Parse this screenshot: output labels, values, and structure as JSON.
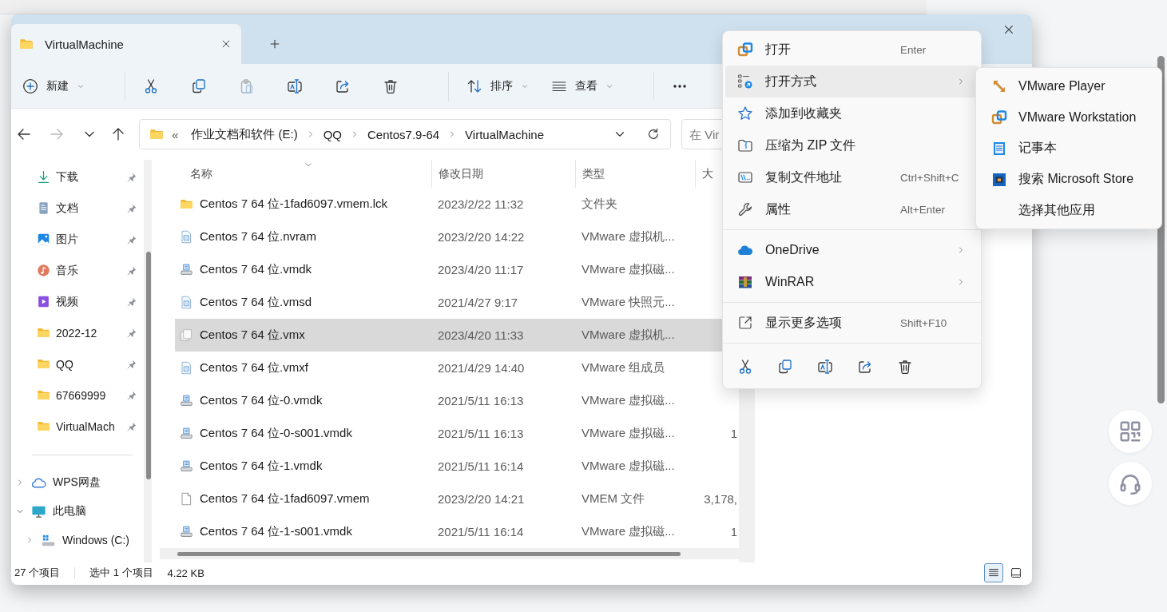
{
  "window": {
    "tabs": [
      {
        "title": "VirtualMachine",
        "selected": true
      }
    ]
  },
  "command_bar": [
    {
      "kind": "new",
      "label": "新建",
      "disabled": false
    },
    {
      "kind": "separator"
    },
    {
      "kind": "cut",
      "disabled": false
    },
    {
      "kind": "copy",
      "disabled": false
    },
    {
      "kind": "paste",
      "disabled": true
    },
    {
      "kind": "rename",
      "disabled": false
    },
    {
      "kind": "share",
      "disabled": false
    },
    {
      "kind": "delete",
      "disabled": false
    },
    {
      "kind": "separator"
    },
    {
      "kind": "sort",
      "label": "排序",
      "disabled": false
    },
    {
      "kind": "view",
      "label": "查看",
      "disabled": false
    },
    {
      "kind": "separator"
    },
    {
      "kind": "more",
      "disabled": false
    }
  ],
  "navigation": [
    {
      "kind": "back",
      "disabled": false
    },
    {
      "kind": "forward",
      "disabled": true
    },
    {
      "kind": "recent",
      "disabled": false
    },
    {
      "kind": "up",
      "disabled": false
    }
  ],
  "address_bar": {
    "overflow": "«",
    "crumbs": [
      "作业文档和软件 (E:)",
      "QQ",
      "Centos7.9-64",
      "VirtualMachine"
    ]
  },
  "search": {
    "placeholder": "在 Vir"
  },
  "sidebar": {
    "quick_access": [
      {
        "label": "下载",
        "kind": "downloads",
        "pinned": true
      },
      {
        "label": "文档",
        "kind": "documents",
        "pinned": true
      },
      {
        "label": "图片",
        "kind": "pictures",
        "pinned": true
      },
      {
        "label": "音乐",
        "kind": "music",
        "pinned": true
      },
      {
        "label": "视频",
        "kind": "videos",
        "pinned": true
      },
      {
        "label": "2022-12",
        "kind": "folder",
        "pinned": true
      },
      {
        "label": "QQ",
        "kind": "folder",
        "pinned": true
      },
      {
        "label": "67669999",
        "kind": "folder",
        "pinned": true
      },
      {
        "label": "VirtualMach",
        "kind": "folder",
        "pinned": true
      }
    ],
    "tree": [
      {
        "label": "WPS网盘",
        "kind": "cloud",
        "expanded": false
      },
      {
        "label": "此电脑",
        "kind": "pc",
        "expanded": true,
        "children": [
          {
            "label": "Windows (C:)",
            "kind": "drive",
            "expanded": false
          }
        ]
      }
    ]
  },
  "file_list": {
    "columns": [
      {
        "label": "名称",
        "sorted": true
      },
      {
        "label": "修改日期",
        "sorted": false
      },
      {
        "label": "类型",
        "sorted": false
      },
      {
        "label": "大",
        "sorted": false
      }
    ],
    "rows": [
      {
        "kind": "folder",
        "name": "Centos 7 64 位-1fad6097.vmem.lck",
        "modified": "2023/2/22 11:32",
        "type": "文件夹",
        "selected": false
      },
      {
        "kind": "config",
        "name": "Centos 7 64 位.nvram",
        "modified": "2023/2/20 14:22",
        "type": "VMware 虚拟机...",
        "selected": false
      },
      {
        "kind": "disk",
        "name": "Centos 7 64 位.vmdk",
        "modified": "2023/4/20 11:17",
        "type": "VMware 虚拟磁...",
        "selected": false
      },
      {
        "kind": "config",
        "name": "Centos 7 64 位.vmsd",
        "modified": "2021/4/27 9:17",
        "type": "VMware 快照元...",
        "selected": false
      },
      {
        "kind": "vm",
        "name": "Centos 7 64 位.vmx",
        "modified": "2023/4/20 11:33",
        "type": "VMware 虚拟机...",
        "selected": true
      },
      {
        "kind": "config",
        "name": "Centos 7 64 位.vmxf",
        "modified": "2021/4/29 14:40",
        "type": "VMware 组成员",
        "selected": false
      },
      {
        "kind": "disk",
        "name": "Centos 7 64 位-0.vmdk",
        "modified": "2021/5/11 16:13",
        "type": "VMware 虚拟磁...",
        "selected": false
      },
      {
        "kind": "disk",
        "name": "Centos 7 64 位-0-s001.vmdk",
        "modified": "2021/5/11 16:13",
        "type": "VMware 虚拟磁...",
        "size": "1",
        "selected": false
      },
      {
        "kind": "disk",
        "name": "Centos 7 64 位-1.vmdk",
        "modified": "2021/5/11 16:14",
        "type": "VMware 虚拟磁...",
        "selected": false
      },
      {
        "kind": "blank",
        "name": "Centos 7 64 位-1fad6097.vmem",
        "modified": "2023/2/20 14:21",
        "type": "VMEM 文件",
        "size": "3,178,",
        "selected": false
      },
      {
        "kind": "disk",
        "name": "Centos 7 64 位-1-s001.vmdk",
        "modified": "2021/5/11 16:14",
        "type": "VMware 虚拟磁...",
        "size": "1",
        "selected": false
      }
    ]
  },
  "status_bar": {
    "count": "27 个项目",
    "selection": "选中 1 个项目",
    "size": "4.22 KB",
    "views": [
      {
        "kind": "details",
        "selected": true
      },
      {
        "kind": "preview",
        "selected": false
      }
    ]
  },
  "context_menu": {
    "items": [
      {
        "kind": "open",
        "label": "打开",
        "shortcut": "Enter",
        "submenu": false,
        "selected": false
      },
      {
        "kind": "open_with",
        "label": "打开方式",
        "submenu": true,
        "selected": true
      },
      {
        "kind": "favorite",
        "label": "添加到收藏夹",
        "submenu": false,
        "selected": false
      },
      {
        "kind": "zip",
        "label": "压缩为 ZIP 文件",
        "submenu": false,
        "selected": false
      },
      {
        "kind": "copy_path",
        "label": "复制文件地址",
        "shortcut": "Ctrl+Shift+C",
        "submenu": false,
        "selected": false
      },
      {
        "kind": "properties",
        "label": "属性",
        "shortcut": "Alt+Enter",
        "submenu": false,
        "selected": false
      },
      {
        "kind": "separator"
      },
      {
        "kind": "onedrive",
        "label": "OneDrive",
        "submenu": true,
        "selected": false
      },
      {
        "kind": "winrar",
        "label": "WinRAR",
        "submenu": true,
        "selected": false
      },
      {
        "kind": "separator"
      },
      {
        "kind": "more_options",
        "label": "显示更多选项",
        "shortcut": "Shift+F10",
        "submenu": false,
        "selected": false
      },
      {
        "kind": "separator"
      }
    ],
    "actions": [
      {
        "kind": "cut"
      },
      {
        "kind": "copy"
      },
      {
        "kind": "rename"
      },
      {
        "kind": "share"
      },
      {
        "kind": "delete"
      }
    ]
  },
  "open_with_menu": {
    "items": [
      {
        "kind": "player",
        "label": "VMware Player"
      },
      {
        "kind": "workstation",
        "label": "VMware Workstation"
      },
      {
        "kind": "notepad",
        "label": "记事本"
      },
      {
        "kind": "store",
        "label": "搜索 Microsoft Store"
      },
      {
        "kind": "none",
        "label": "选择其他应用"
      }
    ]
  }
}
